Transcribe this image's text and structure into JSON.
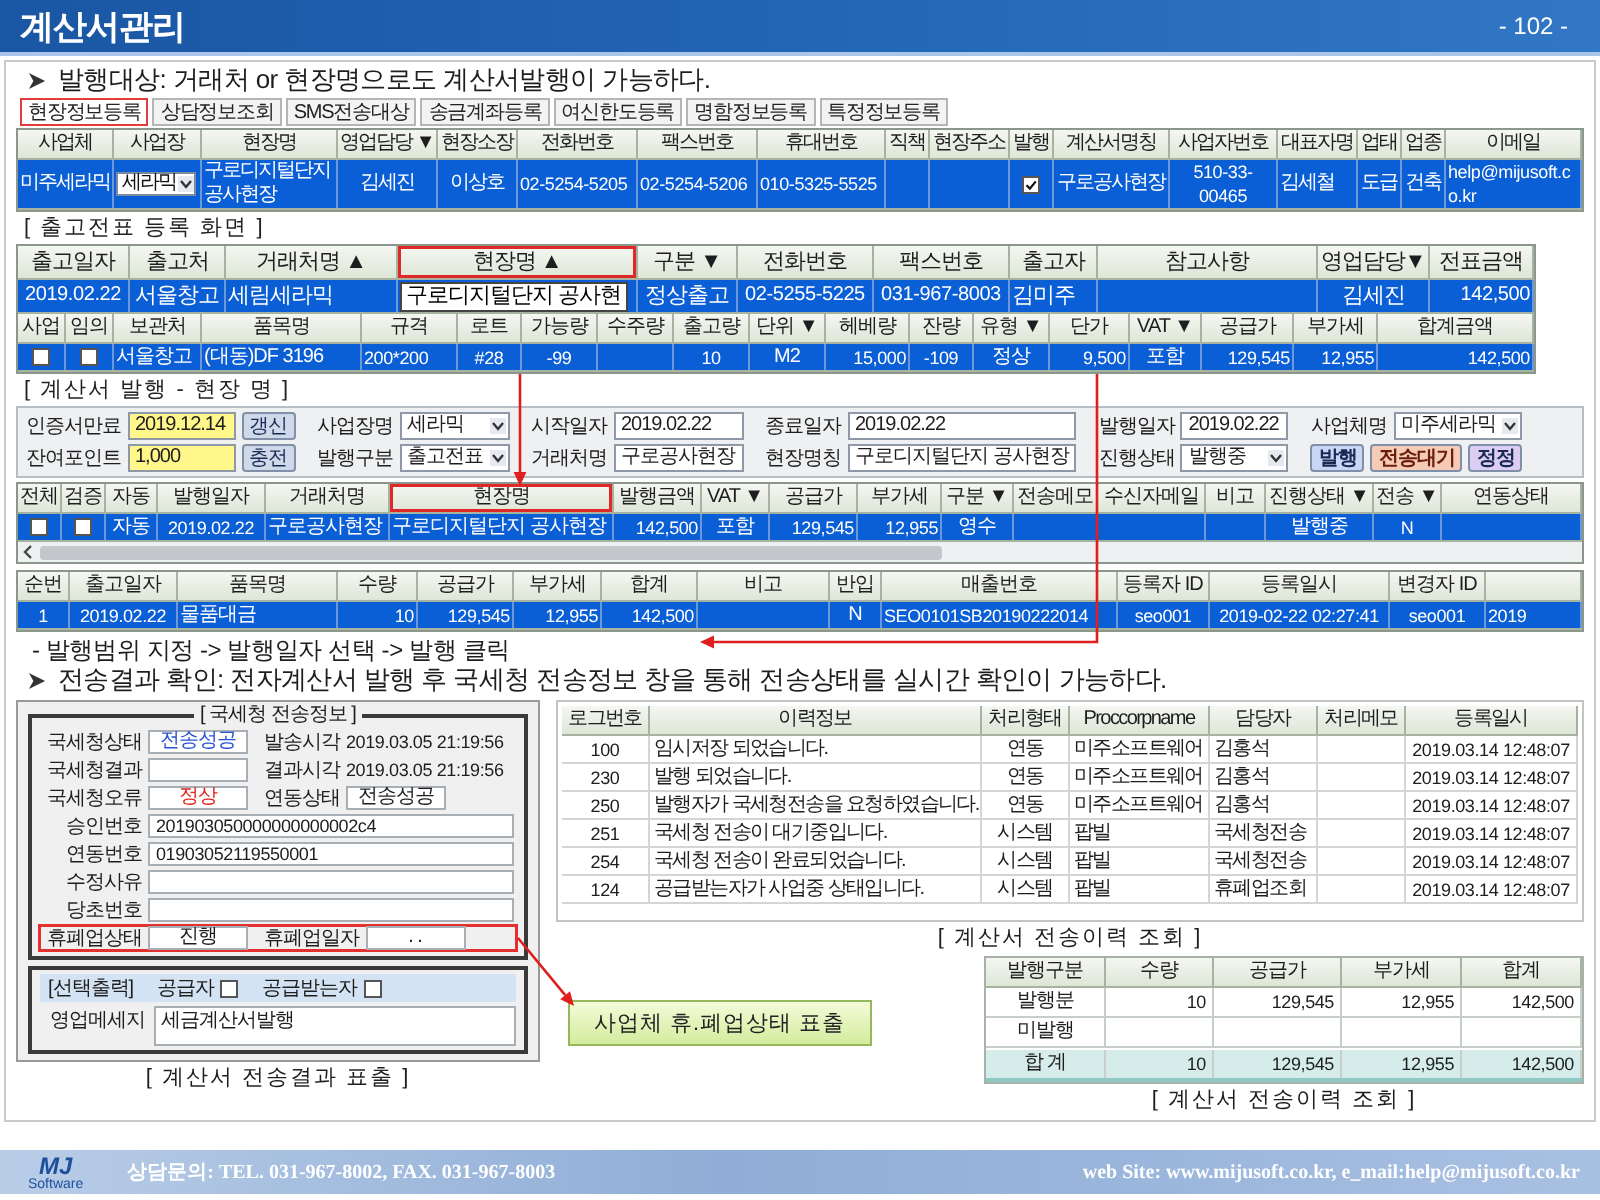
{
  "header": {
    "title": "계산서관리",
    "page_number": "- 102 -"
  },
  "intro": "발행대상: 거래처 or 현장명으로도 계산서발행이 가능하다.",
  "site_tabs": [
    {
      "label": "현장정보등록",
      "selected": true
    },
    {
      "label": "상담정보조회",
      "selected": false
    },
    {
      "label": "SMS전송대상",
      "selected": false
    },
    {
      "label": "송금계좌등록",
      "selected": false
    },
    {
      "label": "여신한도등록",
      "selected": false
    },
    {
      "label": "명함정보등록",
      "selected": false
    },
    {
      "label": "특정정보등록",
      "selected": false
    }
  ],
  "site_table": {
    "columns": [
      "사업체",
      "사업장",
      "현장명",
      "영업담당 ▼",
      "현장소장",
      "전화번호",
      "팩스번호",
      "휴대번호",
      "직책",
      "현장주소",
      "발행",
      "계산서명칭",
      "사업자번호",
      "대표자명",
      "업태",
      "업종",
      "이메일"
    ],
    "rows": [
      {
        "selected": true,
        "cells": [
          {
            "kind": "text",
            "text": "미주세라믹"
          },
          {
            "kind": "combo",
            "text": "세라믹"
          },
          {
            "kind": "text",
            "text": "구로디지털단지 공사현장"
          },
          {
            "kind": "text",
            "text": "김세진"
          },
          {
            "kind": "text",
            "text": "이상호"
          },
          {
            "kind": "text",
            "text": "02-5254-5205"
          },
          {
            "kind": "text",
            "text": "02-5254-5206"
          },
          {
            "kind": "text",
            "text": "010-5325-5525"
          },
          {
            "kind": "blank"
          },
          {
            "kind": "blank"
          },
          {
            "kind": "check",
            "checked": true
          },
          {
            "kind": "text",
            "text": "구로공사현장"
          },
          {
            "kind": "text",
            "text": "510-33-00465"
          },
          {
            "kind": "text",
            "text": "김세철"
          },
          {
            "kind": "text",
            "text": "도급"
          },
          {
            "kind": "text",
            "text": "건축"
          },
          {
            "kind": "text",
            "text": "help@mijusoft.co.kr"
          }
        ]
      }
    ]
  },
  "release_slip": {
    "caption": "[ 출고전표 등록 화면 ]",
    "columns": [
      {
        "label": "출고일자",
        "highlighted": false
      },
      {
        "label": "출고처",
        "highlighted": false
      },
      {
        "label": "거래처명 ▲",
        "highlighted": false
      },
      {
        "label": "현장명 ▲",
        "highlighted": true
      },
      {
        "label": "구분 ▼",
        "highlighted": false
      },
      {
        "label": "전화번호",
        "highlighted": false
      },
      {
        "label": "팩스번호",
        "highlighted": false
      },
      {
        "label": "출고자",
        "highlighted": false
      },
      {
        "label": "참고사항",
        "highlighted": false
      },
      {
        "label": "영업담당▼",
        "highlighted": false
      },
      {
        "label": "전표금액",
        "highlighted": false
      }
    ],
    "rows": [
      {
        "selected": true,
        "cells": [
          {
            "kind": "text",
            "text": "2019.02.22"
          },
          {
            "kind": "text",
            "text": "서울창고"
          },
          {
            "kind": "text",
            "text": "세림세라믹"
          },
          {
            "kind": "edit",
            "text": "구로디지털단지 공사현"
          },
          {
            "kind": "text",
            "text": "정상출고"
          },
          {
            "kind": "text",
            "text": "02-5255-5225"
          },
          {
            "kind": "text",
            "text": "031-967-8003"
          },
          {
            "kind": "text",
            "text": "김미주"
          },
          {
            "kind": "blank"
          },
          {
            "kind": "text",
            "text": "김세진"
          },
          {
            "kind": "text",
            "text": "142,500"
          }
        ]
      }
    ],
    "detail_columns": [
      "사업",
      "임의",
      "보관처",
      "품목명",
      "규격",
      "로트",
      "가능량",
      "수주량",
      "출고량",
      "단위 ▼",
      "헤베량",
      "잔량",
      "유형 ▼",
      "단가",
      "VAT ▼",
      "공급가",
      "부가세",
      "합계금액"
    ],
    "detail_rows": [
      {
        "selected": true,
        "cells": [
          {
            "kind": "check",
            "checked": false
          },
          {
            "kind": "check",
            "checked": false
          },
          {
            "kind": "text",
            "text": "서울창고"
          },
          {
            "kind": "text",
            "text": "(대동)DF 3196"
          },
          {
            "kind": "text",
            "text": "200*200"
          },
          {
            "kind": "text",
            "text": "#28"
          },
          {
            "kind": "text",
            "text": "-99"
          },
          {
            "kind": "blank"
          },
          {
            "kind": "text",
            "text": "10"
          },
          {
            "kind": "text",
            "text": "M2"
          },
          {
            "kind": "text",
            "text": "15,000"
          },
          {
            "kind": "text",
            "text": "-109"
          },
          {
            "kind": "text",
            "text": "정상"
          },
          {
            "kind": "text",
            "text": "9,500"
          },
          {
            "kind": "text",
            "text": "포함"
          },
          {
            "kind": "text",
            "text": "129,545"
          },
          {
            "kind": "text",
            "text": "12,955"
          },
          {
            "kind": "text",
            "text": "142,500"
          }
        ]
      }
    ]
  },
  "invoice_issue": {
    "caption": "[ 계산서 발행 - 현장 명 ]",
    "form": [
      [
        {
          "label": "인증서만료",
          "controls": [
            {
              "kind": "field",
              "value": "2019.12.14",
              "highlighted": true
            },
            {
              "kind": "button",
              "text": "갱신"
            }
          ]
        },
        {
          "label": "사업장명",
          "controls": [
            {
              "kind": "combo",
              "value": "세라믹"
            }
          ]
        },
        {
          "label": "시작일자",
          "controls": [
            {
              "kind": "field",
              "value": "2019.02.22",
              "highlighted": false
            }
          ]
        },
        {
          "label": "종료일자",
          "controls": [
            {
              "kind": "field",
              "value": "2019.02.22",
              "highlighted": false
            }
          ]
        },
        {
          "label": "발행일자",
          "controls": [
            {
              "kind": "field",
              "value": "2019.02.22",
              "highlighted": false
            }
          ]
        },
        {
          "label": "사업체명",
          "controls": [
            {
              "kind": "combo",
              "value": "미주세라믹"
            }
          ]
        }
      ],
      [
        {
          "label": "잔여포인트",
          "controls": [
            {
              "kind": "field",
              "value": "1,000",
              "highlighted": true
            },
            {
              "kind": "button",
              "text": "충전"
            }
          ]
        },
        {
          "label": "발행구분",
          "controls": [
            {
              "kind": "combo",
              "value": "출고전표"
            }
          ]
        },
        {
          "label": "거래처명",
          "controls": [
            {
              "kind": "field",
              "value": "구로공사현장",
              "highlighted": false
            }
          ]
        },
        {
          "label": "현장명칭",
          "controls": [
            {
              "kind": "field",
              "value": "구로디지털단지 공사현장",
              "highlighted": false
            }
          ]
        },
        {
          "label": "진행상태",
          "controls": [
            {
              "kind": "combo",
              "value": "발행중"
            }
          ]
        },
        {
          "controls": [
            {
              "kind": "button",
              "text": "발행"
            },
            {
              "kind": "button",
              "text": "전송대기"
            },
            {
              "kind": "button",
              "text": "정정"
            }
          ]
        }
      ]
    ],
    "columns": [
      {
        "label": "전체",
        "highlighted": false
      },
      {
        "label": "검증",
        "highlighted": false
      },
      {
        "label": "자동",
        "highlighted": false
      },
      {
        "label": "발행일자",
        "highlighted": false
      },
      {
        "label": "거래처명",
        "highlighted": false
      },
      {
        "label": "현장명",
        "highlighted": true
      },
      {
        "label": "발행금액",
        "highlighted": false
      },
      {
        "label": "VAT ▼",
        "highlighted": false
      },
      {
        "label": "공급가",
        "highlighted": false
      },
      {
        "label": "부가세",
        "highlighted": false
      },
      {
        "label": "구분 ▼",
        "highlighted": false
      },
      {
        "label": "전송메모",
        "highlighted": false
      },
      {
        "label": "수신자메일",
        "highlighted": false
      },
      {
        "label": "비고",
        "highlighted": false
      },
      {
        "label": "진행상태 ▼",
        "highlighted": false
      },
      {
        "label": "전송 ▼",
        "highlighted": false
      },
      {
        "label": "연동상태",
        "highlighted": false
      }
    ],
    "rows": [
      {
        "selected": true,
        "cells": [
          {
            "kind": "check",
            "checked": false
          },
          {
            "kind": "check",
            "checked": false
          },
          {
            "kind": "text",
            "text": "자동"
          },
          {
            "kind": "text",
            "text": "2019.02.22"
          },
          {
            "kind": "text",
            "text": "구로공사현장"
          },
          {
            "kind": "text",
            "text": "구로디지털단지 공사현장"
          },
          {
            "kind": "text",
            "text": "142,500"
          },
          {
            "kind": "text",
            "text": "포함"
          },
          {
            "kind": "text",
            "text": "129,545"
          },
          {
            "kind": "text",
            "text": "12,955"
          },
          {
            "kind": "text",
            "text": "영수"
          },
          {
            "kind": "blank"
          },
          {
            "kind": "blank"
          },
          {
            "kind": "blank"
          },
          {
            "kind": "text",
            "text": "발행중"
          },
          {
            "kind": "text",
            "text": "N"
          },
          {
            "kind": "blank"
          }
        ]
      }
    ]
  },
  "slip_items": {
    "columns": [
      "순번",
      "출고일자",
      "품목명",
      "수량",
      "공급가",
      "부가세",
      "합계",
      "비고",
      "반입",
      "매출번호",
      "등록자 ID",
      "등록일시",
      "변경자 ID"
    ],
    "rows": [
      {
        "selected": true,
        "cells": [
          {
            "kind": "text",
            "text": "1"
          },
          {
            "kind": "text",
            "text": "2019.02.22"
          },
          {
            "kind": "text",
            "text": "물품대금"
          },
          {
            "kind": "text",
            "text": "10"
          },
          {
            "kind": "text",
            "text": "129,545"
          },
          {
            "kind": "text",
            "text": "12,955"
          },
          {
            "kind": "text",
            "text": "142,500"
          },
          {
            "kind": "blank"
          },
          {
            "kind": "text",
            "text": "N"
          },
          {
            "kind": "text",
            "text": "SEO0101SB20190222014"
          },
          {
            "kind": "text",
            "text": "seo001"
          },
          {
            "kind": "text",
            "text": "2019-02-22 02:27:41"
          },
          {
            "kind": "text",
            "text": "seo001"
          },
          {
            "kind": "text",
            "text": "2019"
          }
        ]
      }
    ]
  },
  "step_note": "-  발행범위 지정 -> 발행일자 선택 -> 발행 클릭",
  "result_note": "전송결과 확인: 전자계산서 발행 후 국세청 전송정보 창을 통해 전송상태를 실시간 확인이 가능하다.",
  "nts_info": {
    "title": "[ 국세청 전송정보 ]",
    "rows": [
      {
        "highlighted": false,
        "items": [
          {
            "kind": "field",
            "label": "국세청상태",
            "value": "전송성공",
            "color": "#2a52d6"
          },
          {
            "kind": "text",
            "label": "발송시각",
            "value": "2019.03.05 21:19:56"
          }
        ]
      },
      {
        "highlighted": false,
        "items": [
          {
            "kind": "field",
            "label": "국세청결과"
          },
          {
            "kind": "text",
            "label": "결과시각",
            "value": "2019.03.05 21:19:56"
          }
        ]
      },
      {
        "highlighted": false,
        "items": [
          {
            "kind": "field",
            "label": "국세청오류",
            "value": "정상",
            "color": "#e0281e"
          },
          {
            "kind": "field",
            "label": "연동상태",
            "value": "전송성공"
          }
        ]
      },
      {
        "highlighted": false,
        "items": [
          {
            "kind": "wide",
            "label": "승인번호",
            "value": "201903050000000000002c4"
          }
        ]
      },
      {
        "highlighted": false,
        "items": [
          {
            "kind": "wide",
            "label": "연동번호",
            "value": "01903052119550001"
          }
        ]
      },
      {
        "highlighted": false,
        "items": [
          {
            "kind": "wide",
            "label": "수정사유"
          }
        ]
      },
      {
        "highlighted": false,
        "items": [
          {
            "kind": "wide",
            "label": "당초번호"
          }
        ]
      },
      {
        "highlighted": true,
        "items": [
          {
            "kind": "field",
            "label": "휴폐업상태",
            "value": "진행"
          },
          {
            "kind": "field",
            "label": "휴폐업일자",
            "value": ". ."
          }
        ]
      }
    ],
    "print_options": {
      "label": "[선택출력]",
      "options": [
        {
          "label": "공급자",
          "checked": false
        },
        {
          "label": "공급받는자",
          "checked": false
        }
      ]
    },
    "message": {
      "label": "영업메세지",
      "value": "세금계산서발행"
    },
    "caption": "[ 계산서 전송결과 표출 ]"
  },
  "callout": "사업체 휴.폐업상태 표출",
  "history": {
    "columns": [
      "로그번호",
      "이력정보",
      "처리형태",
      "Proccorpname",
      "담당자",
      "처리메모",
      "등록일시"
    ],
    "rows": [
      {
        "log_no": "100",
        "message": "임시저장 되었습니다.",
        "process_type": "연동",
        "corp_name": "미주소프트웨어",
        "handler": "김홍석",
        "registered_at": "2019.03.14 12:48:07"
      },
      {
        "log_no": "230",
        "message": "발행 되었습니다.",
        "process_type": "연동",
        "corp_name": "미주소프트웨어",
        "handler": "김홍석",
        "registered_at": "2019.03.14 12:48:07"
      },
      {
        "log_no": "250",
        "message": "발행자가 국세청전송을 요청하였습니다.",
        "process_type": "연동",
        "corp_name": "미주소프트웨어",
        "handler": "김홍석",
        "registered_at": "2019.03.14 12:48:07"
      },
      {
        "log_no": "251",
        "message": "국세청 전송이 대기중입니다.",
        "process_type": "시스템",
        "corp_name": "팝빌",
        "handler": "국세청전송",
        "registered_at": "2019.03.14 12:48:07"
      },
      {
        "log_no": "254",
        "message": "국세청 전송이 완료되었습니다.",
        "process_type": "시스템",
        "corp_name": "팝빌",
        "handler": "국세청전송",
        "registered_at": "2019.03.14 12:48:07"
      },
      {
        "log_no": "124",
        "message": "공급받는자가 사업중 상태입니다.",
        "process_type": "시스템",
        "corp_name": "팝빌",
        "handler": "휴폐업조회",
        "registered_at": "2019.03.14 12:48:07"
      }
    ],
    "caption": "[ 계산서 전송이력 조회 ]"
  },
  "summary": {
    "columns": [
      "발행구분",
      "수량",
      "공급가",
      "부가세",
      "합계"
    ],
    "rows": [
      {
        "kind": "normal",
        "label": "발행분",
        "qty": "10",
        "supply": "129,545",
        "vat": "12,955",
        "total": "142,500"
      },
      {
        "kind": "normal",
        "label": "미발행"
      },
      {
        "kind": "total",
        "label": "합 계",
        "qty": "10",
        "supply": "129,545",
        "vat": "12,955",
        "total": "142,500"
      }
    ],
    "caption": "[ 계산서 전송이력 조회 ]"
  },
  "footer": {
    "logo": "MJ",
    "logo_sub": "Software",
    "contact": "상담문의: TEL. 031-967-8002,  FAX. 031-967-8003",
    "web": "web Site: www.mijusoft.co.kr,  e_mail:help@mijusoft.co.kr"
  }
}
